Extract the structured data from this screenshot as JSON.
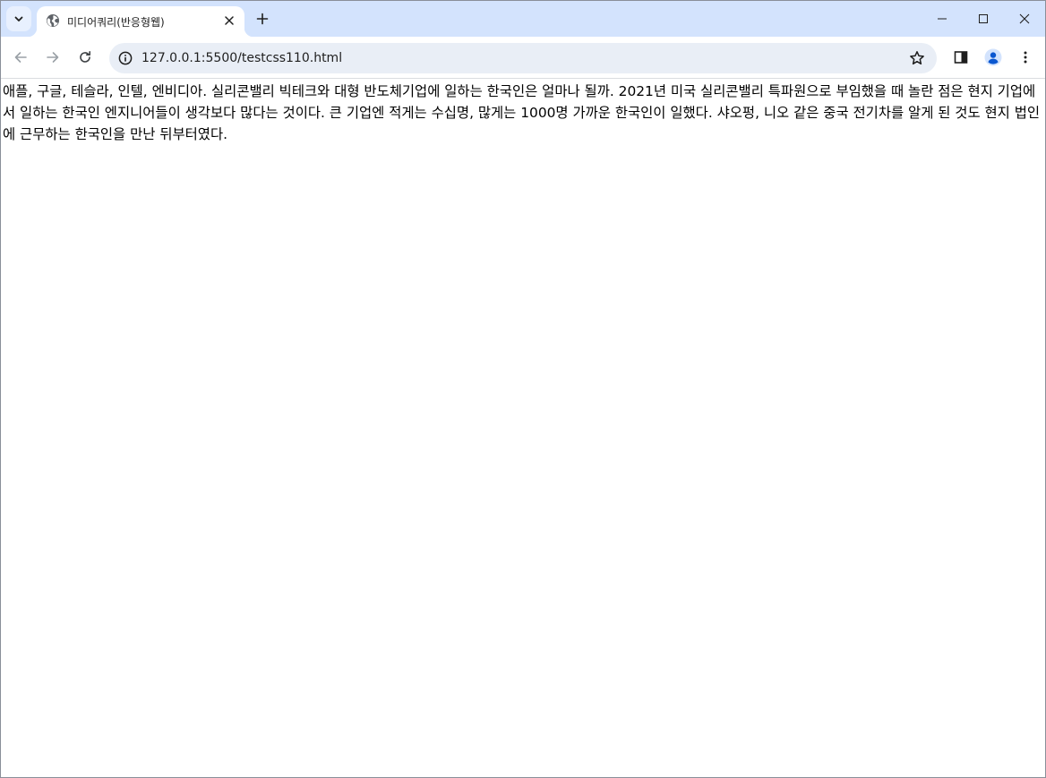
{
  "browser": {
    "tab": {
      "title": "미디어쿼리(반응형웹)"
    },
    "address_bar": {
      "url": "127.0.0.1:5500/testcss110.html"
    },
    "colors": {
      "tabstrip_bg": "#d3e3fd",
      "omnibox_bg": "#e9eef6",
      "profile_accent": "#0b57d0"
    }
  },
  "page": {
    "body_text": "애플, 구글, 테슬라, 인텔, 엔비디아. 실리콘밸리 빅테크와 대형 반도체기업에 일하는 한국인은 얼마나 될까. 2021년 미국 실리콘밸리 특파원으로 부임했을 때 놀란 점은 현지 기업에서 일하는 한국인 엔지니어들이 생각보다 많다는 것이다. 큰 기업엔 적게는 수십명, 많게는 1000명 가까운 한국인이 일했다. 샤오펑, 니오 같은 중국 전기차를 알게 된 것도 현지 법인에 근무하는 한국인을 만난 뒤부터였다."
  }
}
